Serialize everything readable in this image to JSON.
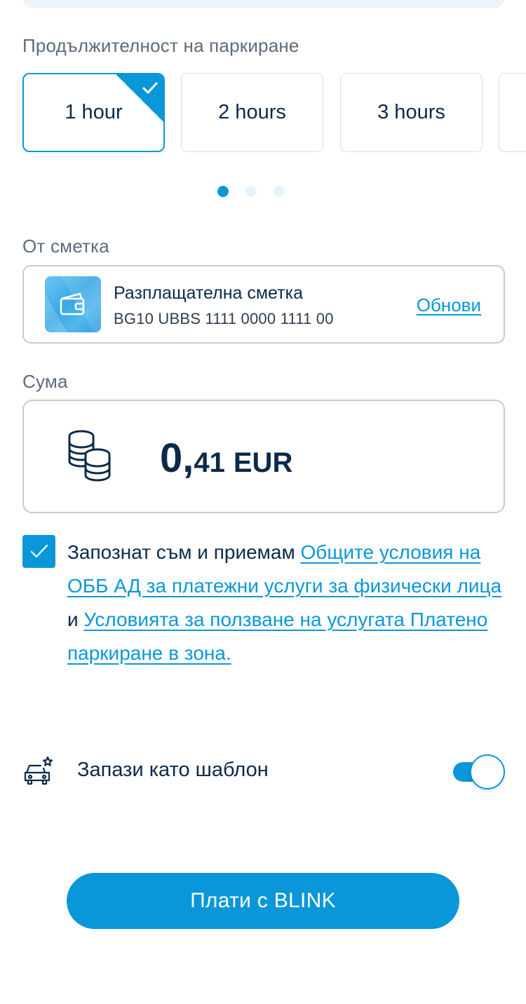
{
  "duration": {
    "label": "Продължителност на паркиране",
    "options": [
      {
        "label": "1 hour",
        "selected": true
      },
      {
        "label": "2 hours",
        "selected": false
      },
      {
        "label": "3 hours",
        "selected": false
      }
    ],
    "pager": {
      "current": 1,
      "total": 3
    }
  },
  "account": {
    "label": "От сметка",
    "name": "Разплащателна сметка",
    "iban": "BG10 UBBS 1111 0000 1111 00",
    "refresh_label": "Обнови",
    "icon": "wallet-icon"
  },
  "amount": {
    "label": "Сума",
    "integer": "0,",
    "decimal": "41",
    "currency": "EUR",
    "icon": "coins-icon"
  },
  "terms": {
    "checked": true,
    "prefix": "Запознат съм и приемам ",
    "link1": "Общите условия на ОББ АД за платежни услуги за физически лица",
    "conjunction": " и ",
    "link2": "Условията за ползване на услугата Платено паркиране в зона."
  },
  "template": {
    "label": "Запази като шаблон",
    "enabled": true,
    "icon": "car-star-icon"
  },
  "pay_button": {
    "label": "Плати с BLINK"
  },
  "colors": {
    "accent": "#0a97d9",
    "text_primary": "#0b2a4a",
    "text_secondary": "#5b6b7b",
    "border": "#c3ccd5"
  }
}
